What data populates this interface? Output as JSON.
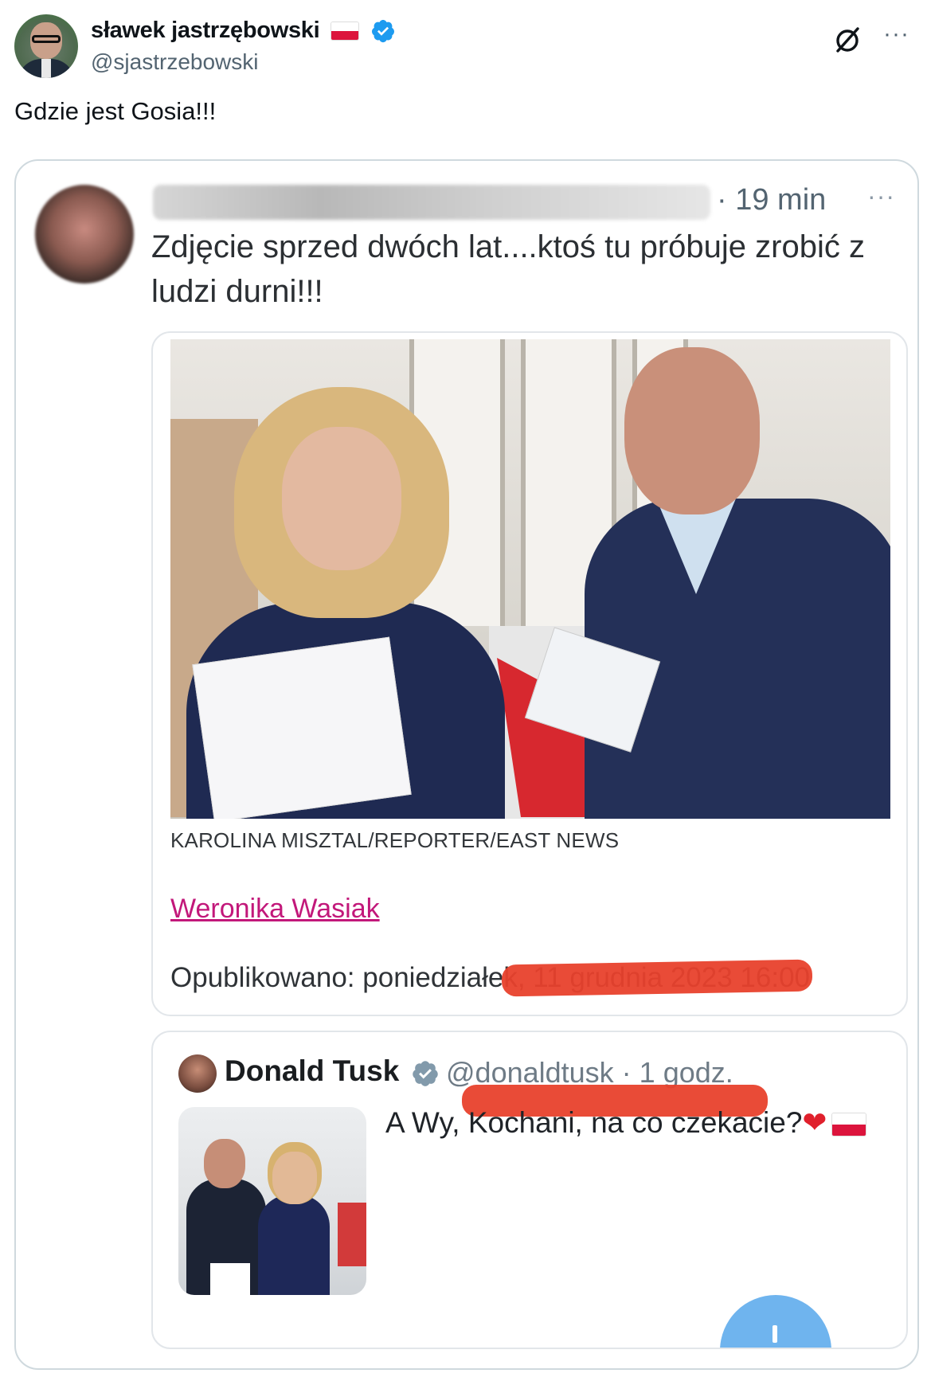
{
  "post": {
    "display_name": "sławek jastrzębowski",
    "handle": "@sjastrzebowski",
    "text": "Gdzie jest Gosia!!!",
    "icons": {
      "flag": "poland-flag-icon",
      "verified": "verified-badge-icon",
      "grok": "grok-icon",
      "more": "more-options-icon"
    },
    "more_label": "···"
  },
  "embedded_screenshot": {
    "inner_post": {
      "time": "· 19 min",
      "more_label": "···",
      "text": "Zdjęcie sprzed dwóch lat....ktoś tu próbuje zrobić z ludzi durni!!!"
    },
    "article": {
      "photo_credit": "KAROLINA MISZTAL/REPORTER/EAST NEWS",
      "author": "Weronika Wasiak",
      "published": "Opublikowano: poniedziałek, 11 grudnia 2023 16:00"
    },
    "quoted_post": {
      "name": "Donald Tusk",
      "handle_time": "@donaldtusk · 1 godz.",
      "text": "A Wy, Kochani, na co czekacie?"
    }
  },
  "colors": {
    "verified": "#1d9bf0",
    "link_magenta": "#c2187a",
    "strike_red": "#e8412c",
    "muted": "#536471"
  }
}
